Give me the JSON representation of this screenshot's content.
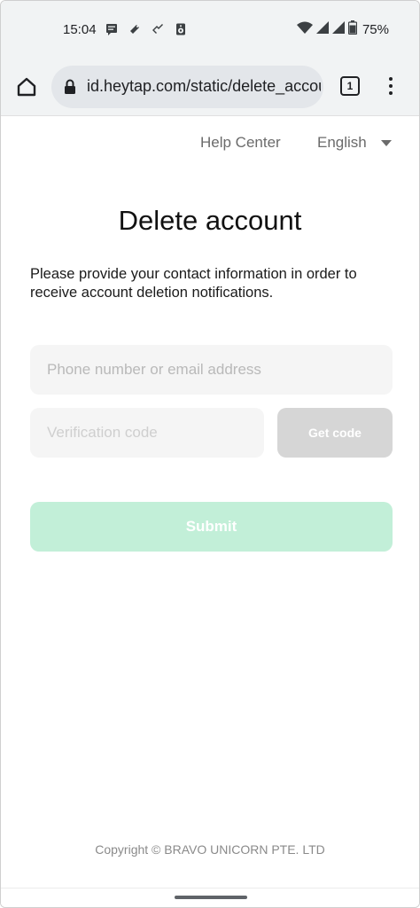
{
  "status_bar": {
    "time": "15:04",
    "battery": "75%",
    "icons": [
      "message-icon",
      "notification-icon",
      "notification-icon",
      "speaker-icon",
      "wifi-icon",
      "signal-icon",
      "signal-icon",
      "battery-icon"
    ]
  },
  "browser": {
    "url": "id.heytap.com/static/delete_account",
    "tab_count": "1"
  },
  "header": {
    "help_center": "Help Center",
    "language": "English"
  },
  "main": {
    "title": "Delete account",
    "description": "Please provide your contact information in order to receive account deletion notifications.",
    "phone_placeholder": "Phone number or email address",
    "code_placeholder": "Verification code",
    "get_code_label": "Get code",
    "submit_label": "Submit"
  },
  "footer": {
    "copyright": "Copyright © BRAVO UNICORN PTE. LTD"
  },
  "colors": {
    "submit_disabled": "#c2efd8",
    "get_code_disabled": "#d6d6d6",
    "input_bg": "#f5f5f5"
  }
}
